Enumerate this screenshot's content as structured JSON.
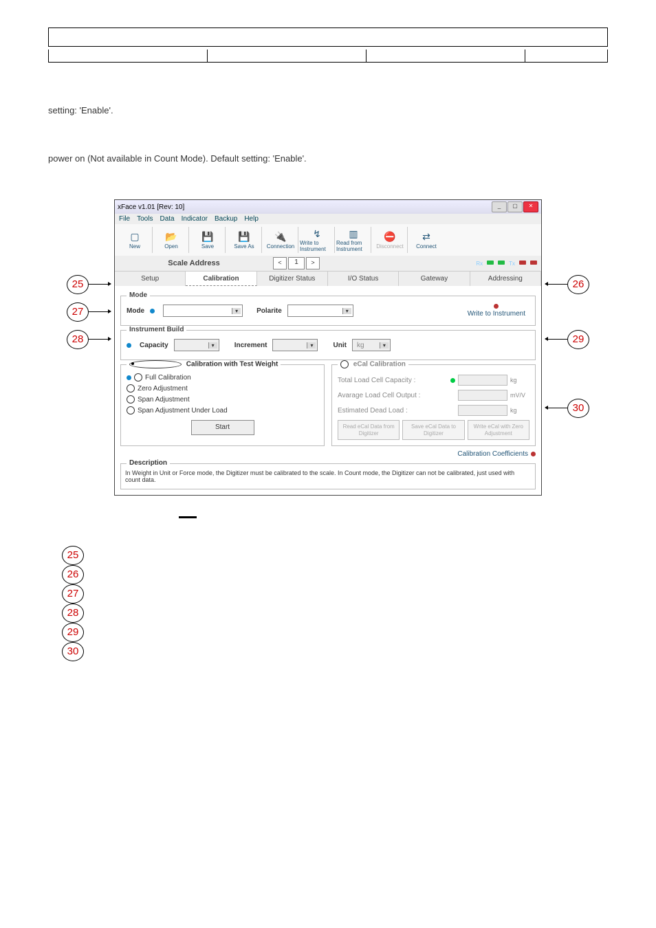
{
  "text": {
    "p1": "setting: 'Enable'.",
    "p2": "power on (Not available in Count Mode). Default setting: 'Enable'."
  },
  "callouts": {
    "left": [
      "25",
      "27",
      "28"
    ],
    "right": [
      "26",
      "29",
      "30"
    ],
    "stack": [
      "25",
      "26",
      "27",
      "28",
      "29",
      "30"
    ]
  },
  "app": {
    "title": "xFace  v1.01     [Rev: 10]",
    "menus": [
      "File",
      "Tools",
      "Data",
      "Indicator",
      "Backup",
      "Help"
    ],
    "toolbar": [
      {
        "lbl": "New",
        "ico": "▢",
        "dis": false
      },
      {
        "lbl": "Open",
        "ico": "📂",
        "dis": false
      },
      {
        "lbl": "Save",
        "ico": "💾",
        "dis": false
      },
      {
        "lbl": "Save As",
        "ico": "💾",
        "dis": false
      },
      {
        "lbl": "Connection",
        "ico": "🔌",
        "dis": false
      },
      {
        "lbl": "Write to Instrument",
        "ico": "↯",
        "dis": false
      },
      {
        "lbl": "Read from Instrument",
        "ico": "▥",
        "dis": false
      },
      {
        "lbl": "Disconnect",
        "ico": "⛔",
        "dis": true
      },
      {
        "lbl": "Connect",
        "ico": "⇄",
        "dis": false
      }
    ],
    "scale_addr_lbl": "Scale Address",
    "scale_addr_val": "1",
    "comm_labels": [
      "Rx",
      ">I<",
      ">I<",
      "Tx",
      "–I–",
      "–I–"
    ],
    "tabs": [
      "Setup",
      "Calibration",
      "Digitizer Status",
      "I/O Status",
      "Gateway",
      "Addressing"
    ],
    "active_tab": 1,
    "mode": {
      "legend": "Mode",
      "mode_lbl": "Mode",
      "polarite_lbl": "Polarite",
      "write_lbl": "Write to Instrument"
    },
    "ib": {
      "legend": "Instrument Build",
      "capacity": "Capacity",
      "increment": "Increment",
      "unit": "Unit",
      "unit_val": "kg"
    },
    "cal_test": {
      "legend": "Calibration with Test Weight",
      "opts": [
        "Full Calibration",
        "Zero Adjustment",
        "Span Adjustment",
        "Span Adjustment Under Load"
      ],
      "start": "Start"
    },
    "ecal": {
      "legend": "eCal Calibration",
      "rows": [
        {
          "l": "Total Load Cell Capacity",
          "u": "kg"
        },
        {
          "l": "Avarage Load Cell Output",
          "u": "mV/V"
        },
        {
          "l": "Estimated Dead Load",
          "u": "kg"
        }
      ],
      "btns": [
        "Read eCal Data from Digitizer",
        "Save eCal Data to Digitizer",
        "Write eCal with Zero Adjustment"
      ],
      "calcoef": "Calibration Coefficients"
    },
    "desc": {
      "legend": "Description",
      "txt": "In Weight in Unit or Force mode, the Digitizer must be calibrated to the scale. In Count mode, the Digitizer can not be calibrated, just used with count data."
    }
  }
}
